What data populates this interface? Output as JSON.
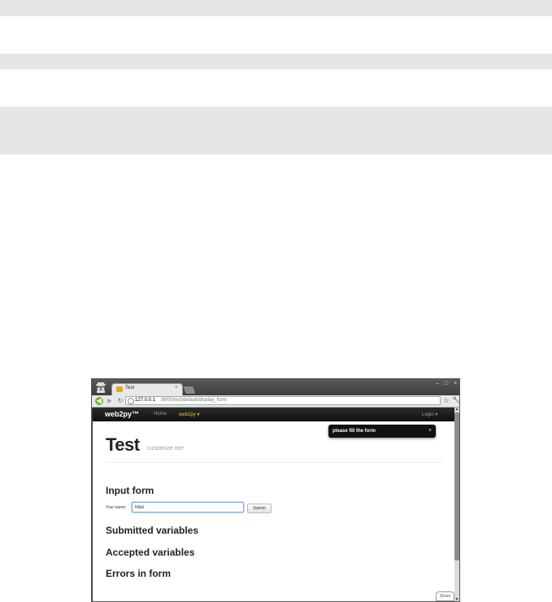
{
  "tab": {
    "title": "Test",
    "close": "×"
  },
  "window_controls": {
    "minimize": "–",
    "maximize": "□",
    "close": "×"
  },
  "toolbar": {
    "back": "◀",
    "forward": "▶",
    "reload": "↻",
    "url_host": "127.0.0.1",
    "url_rest": ":8000/test/default/display_form",
    "star": "☆",
    "wrench": "🔧"
  },
  "navbar": {
    "brand": "web2py™",
    "home": "Home",
    "web2py_menu": "web2py ▾",
    "login": "Login ▾"
  },
  "flash": {
    "message": "please fill the form",
    "close": "×"
  },
  "page": {
    "title": "Test",
    "subtitle": "customize me!"
  },
  "form": {
    "heading": "Input form",
    "name_label": "Your name:",
    "name_value": "Max",
    "submit_label": "Submit"
  },
  "sections": {
    "submitted": "Submitted variables",
    "accepted": "Accepted variables",
    "errors": "Errors in form"
  },
  "share": {
    "label": "Share"
  },
  "scrollbar": {
    "up": "▲",
    "down": "▼"
  }
}
